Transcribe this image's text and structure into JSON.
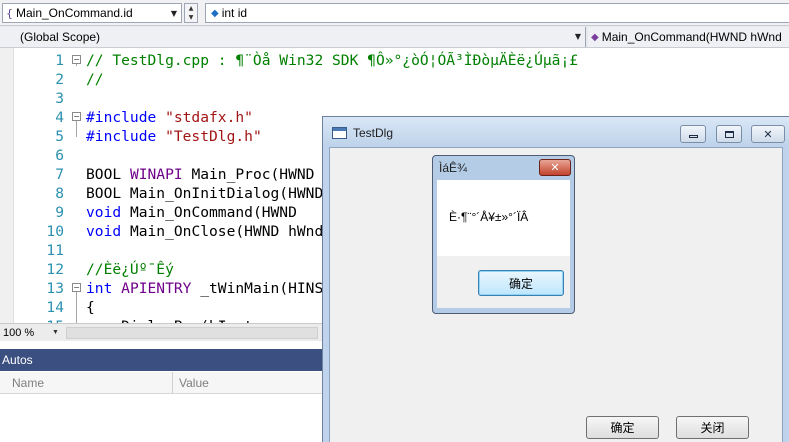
{
  "navbar": {
    "members_combo": "Main_OnCommand.id",
    "declaration_combo": "int id",
    "scope_combo": "(Global Scope)",
    "function_combo": "Main_OnCommand(HWND hWnd"
  },
  "editor": {
    "lines": [
      {
        "n": "1",
        "fold": "⊟",
        "segs": [
          {
            "c": "c-com",
            "t": "// TestDlg.cpp : ¶¨Òå Win32 SDK ¶Ô»°¿òÓ¦ÓÃ³ÌÐòµÄÈë¿Úµã¡£"
          }
        ]
      },
      {
        "n": "2",
        "fold": "",
        "segs": [
          {
            "c": "c-com",
            "t": "//"
          }
        ]
      },
      {
        "n": "3",
        "fold": "",
        "segs": []
      },
      {
        "n": "4",
        "fold": "⊟",
        "segs": [
          {
            "c": "c-pre",
            "t": "#include "
          },
          {
            "c": "c-str",
            "t": "\"stdafx.h\""
          }
        ]
      },
      {
        "n": "5",
        "fold": "",
        "segs": [
          {
            "c": "c-pre",
            "t": "#include "
          },
          {
            "c": "c-str",
            "t": "\"TestDlg.h\""
          }
        ]
      },
      {
        "n": "6",
        "fold": "",
        "segs": []
      },
      {
        "n": "7",
        "fold": "",
        "segs": [
          {
            "c": "",
            "t": "BOOL "
          },
          {
            "c": "c-mac",
            "t": "WINAPI"
          },
          {
            "c": "",
            "t": " Main_Proc(HWND"
          }
        ]
      },
      {
        "n": "8",
        "fold": "",
        "segs": [
          {
            "c": "",
            "t": "BOOL Main_OnInitDialog(HWND"
          }
        ]
      },
      {
        "n": "9",
        "fold": "",
        "segs": [
          {
            "c": "c-kw",
            "t": "void"
          },
          {
            "c": "",
            "t": " Main_OnCommand(HWND"
          }
        ]
      },
      {
        "n": "10",
        "fold": "",
        "segs": [
          {
            "c": "c-kw",
            "t": "void"
          },
          {
            "c": "",
            "t": " Main_OnClose(HWND hWnd"
          }
        ]
      },
      {
        "n": "11",
        "fold": "",
        "segs": []
      },
      {
        "n": "12",
        "fold": "",
        "segs": [
          {
            "c": "c-com",
            "t": "//Èë¿Úº¯Êý"
          }
        ]
      },
      {
        "n": "13",
        "fold": "⊟",
        "segs": [
          {
            "c": "c-kw",
            "t": "int"
          },
          {
            "c": "",
            "t": " "
          },
          {
            "c": "c-mac",
            "t": "APIENTRY"
          },
          {
            "c": "",
            "t": " _tWinMain(HINSTANCE"
          }
        ]
      },
      {
        "n": "14",
        "fold": "",
        "segs": [
          {
            "c": "",
            "t": "{"
          }
        ]
      },
      {
        "n": "15",
        "fold": "",
        "segs": [
          {
            "c": "",
            "t": "    DialogBox(hInstance,"
          }
        ]
      }
    ],
    "zoom": "100 %"
  },
  "autos": {
    "title": "Autos",
    "col_name": "Name",
    "col_value": "Value"
  },
  "testdlg": {
    "title": "TestDlg",
    "ok_label": "确定",
    "close_label": "关闭"
  },
  "msgbox": {
    "title": "ÌáÊ¾",
    "close_glyph": "✕",
    "text": "È·¶¨°´Å¥±»°´ÏÂ",
    "ok_label": "确定"
  }
}
